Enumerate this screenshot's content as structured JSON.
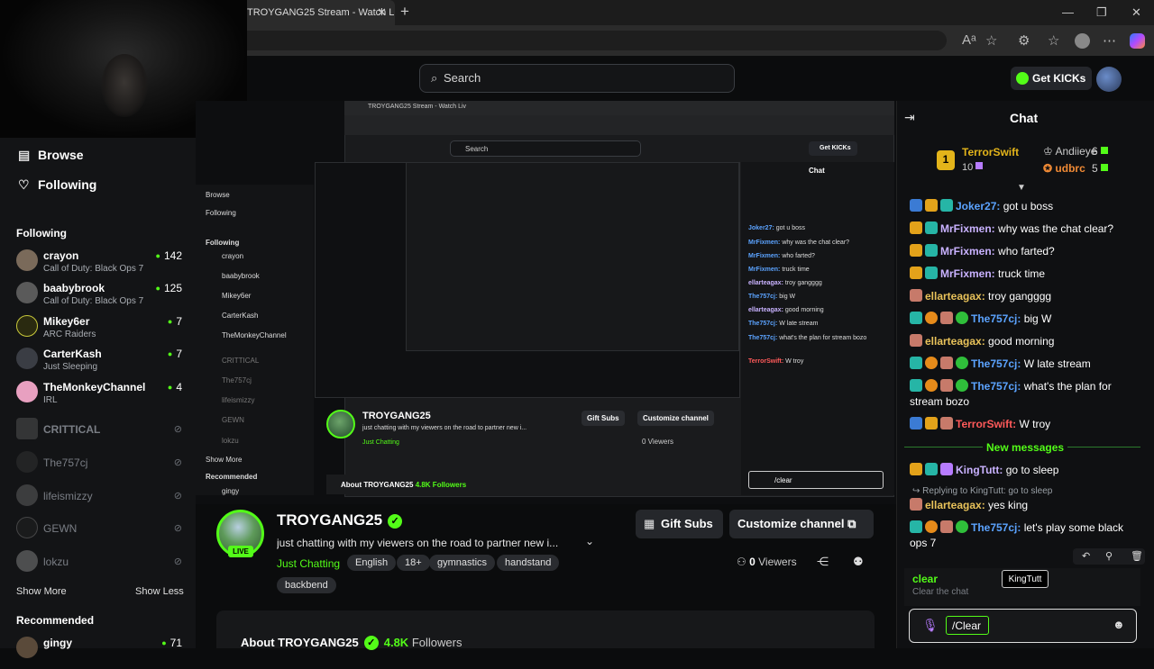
{
  "browser": {
    "tab_title": "TROYGANG25 Stream - Watch Li",
    "tab_close": "✕",
    "new_tab": "+",
    "minimize": "—",
    "maximize": "❐",
    "close": "✕"
  },
  "header": {
    "search_placeholder": "Search",
    "get_kicks": "Get KICKs"
  },
  "sidebar": {
    "browse": "Browse",
    "following_nav": "Following",
    "following_heading": "Following",
    "channels": [
      {
        "name": "crayon",
        "category": "Call of Duty: Black Ops 7",
        "viewers": "142"
      },
      {
        "name": "baabybrook",
        "category": "Call of Duty: Black Ops 7",
        "viewers": "125"
      },
      {
        "name": "Mikey6er",
        "category": "ARC Raiders",
        "viewers": "7"
      },
      {
        "name": "CarterKash",
        "category": "Just Sleeping",
        "viewers": "7"
      },
      {
        "name": "TheMonkeyChannel",
        "category": "IRL",
        "viewers": "4"
      }
    ],
    "offline": [
      "CRITTICAL",
      "The757cj",
      "lifeismizzy",
      "GEWN",
      "lokzu"
    ],
    "show_more": "Show More",
    "show_less": "Show Less",
    "recommended_heading": "Recommended",
    "recommended": [
      {
        "name": "gingy",
        "viewers": "71"
      }
    ]
  },
  "stream": {
    "name": "TROYGANG25",
    "live": "LIVE",
    "title": "just chatting with my viewers on the road to partner new i...",
    "category": "Just Chatting",
    "tags": [
      "English",
      "18+",
      "gymnastics",
      "handstand",
      "backbend"
    ],
    "gift_subs": "Gift Subs",
    "customize": "Customize channel",
    "viewers_count": "0",
    "viewers_label": "Viewers",
    "about": "About TROYGANG25",
    "followers_count": "4.8K",
    "followers_label": "Followers"
  },
  "chat": {
    "title": "Chat",
    "leaderboard": [
      {
        "rank": "1",
        "name": "TerrorSwift",
        "count": "10"
      },
      {
        "name": "Andiieye",
        "count": "6"
      },
      {
        "name": "udbrc",
        "count": "5"
      }
    ],
    "messages": [
      {
        "user": "Joker27:",
        "text": " got u boss"
      },
      {
        "user": "MrFixmen:",
        "text": " why was the chat clear?"
      },
      {
        "user": "MrFixmen:",
        "text": " who farted?"
      },
      {
        "user": "MrFixmen:",
        "text": " truck time"
      },
      {
        "user": "ellarteagax:",
        "text": " troy gangggg"
      },
      {
        "user": "The757cj:",
        "text": " big W"
      },
      {
        "user": "ellarteagax:",
        "text": " good morning"
      },
      {
        "user": "The757cj:",
        "text": " W late stream"
      },
      {
        "user": "The757cj:",
        "text": " what's the plan for stream bozo"
      },
      {
        "user": "TerrorSwift:",
        "text": " W troy"
      },
      {
        "user": "KingTutt:",
        "text": " go to sleep"
      },
      {
        "user": "ellarteagax:",
        "text": " yes king"
      },
      {
        "user": "The757cj:",
        "text": " let's play some black ops 7"
      }
    ],
    "new_messages": "New messages",
    "reply_context": "Replying to KingTutt: go to sleep",
    "tooltip": "KingTutt",
    "command_name": "clear",
    "command_desc": "Clear the chat",
    "input_value": "/Clear"
  },
  "nested": {
    "tab_title": "TROYGANG25 Stream - Watch Liv",
    "search": "Search",
    "get_kicks": "Get KICKs",
    "sidebar_items": [
      "Browse",
      "Following",
      "Following",
      "crayon",
      "baabybrook",
      "Mikey6er",
      "CarterKash",
      "TheMonkeyChannel",
      "CRITTICAL",
      "The757cj",
      "lifeismizzy",
      "GEWN",
      "lokzu",
      "Show More",
      "Recommended",
      "gingy"
    ],
    "chat_lines": [
      {
        "user": "Joker27:",
        "text": " got u boss"
      },
      {
        "user": "MrFixmen:",
        "text": " why was the chat clear?"
      },
      {
        "user": "MrFixmen:",
        "text": " who farted?"
      },
      {
        "user": "MrFixmen:",
        "text": " truck time"
      },
      {
        "user": "ellarteagax:",
        "text": " troy gangggg"
      },
      {
        "user": "The757cj:",
        "text": " big W"
      },
      {
        "user": "ellarteagax:",
        "text": " good morning"
      },
      {
        "user": "The757cj:",
        "text": " W late stream"
      },
      {
        "user": "The757cj:",
        "text": " what's the plan for stream bozo"
      },
      {
        "user": "TerrorSwift:",
        "text": " W troy"
      }
    ],
    "stream_name": "TROYGANG25",
    "stream_title": "just chatting with my viewers on the road to partner new i...",
    "stream_category": "Just Chatting",
    "gift_subs": "Gift Subs",
    "customize": "Customize channel",
    "viewers": "0 Viewers",
    "about": "About TROYGANG25",
    "followers": "4.8K Followers",
    "chat_title": "Chat",
    "input_value": "/clear"
  }
}
